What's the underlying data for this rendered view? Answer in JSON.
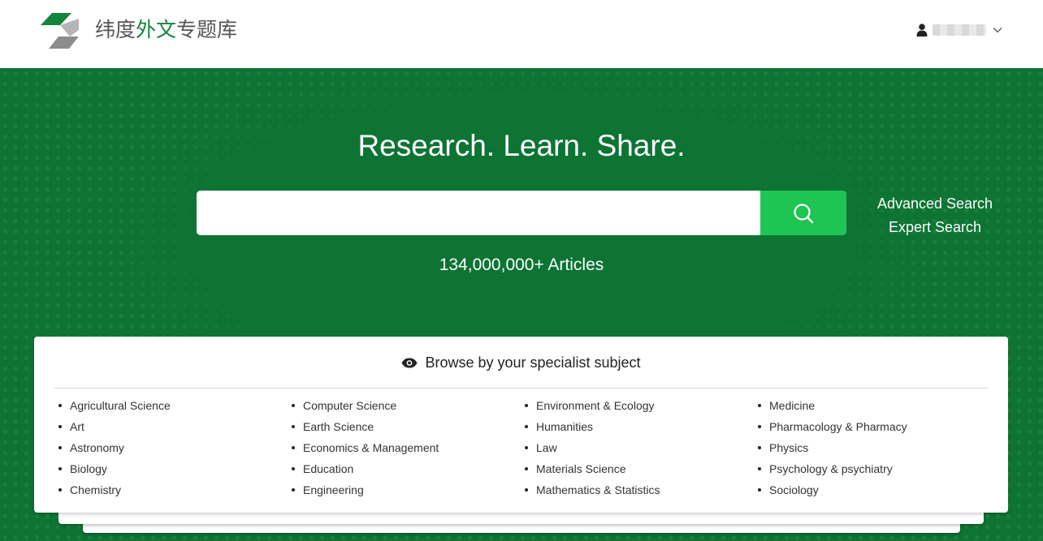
{
  "header": {
    "logo_prefix": "纬度",
    "logo_accent": "外文",
    "logo_suffix": "专题库",
    "user_name": "",
    "brand_green": "#12843c",
    "logo_gray": "#8c8c8c"
  },
  "hero": {
    "tagline": "Research. Learn. Share.",
    "search_placeholder": "",
    "search_value": "",
    "advanced_search_label": "Advanced Search",
    "expert_search_label": "Expert Search",
    "article_count": "134,000,000+ Articles",
    "background_color": "#0d7434",
    "search_button_color": "#1ec553"
  },
  "subjects": {
    "title": "Browse by your specialist subject",
    "columns": [
      [
        "Agricultural Science",
        "Art",
        "Astronomy",
        "Biology",
        "Chemistry"
      ],
      [
        "Computer Science",
        "Earth Science",
        "Economics & Management",
        "Education",
        "Engineering"
      ],
      [
        "Environment & Ecology",
        "Humanities",
        "Law",
        "Materials Science",
        "Mathematics & Statistics"
      ],
      [
        "Medicine",
        "Pharmacology & Pharmacy",
        "Physics",
        "Psychology & psychiatry",
        "Sociology"
      ]
    ]
  }
}
